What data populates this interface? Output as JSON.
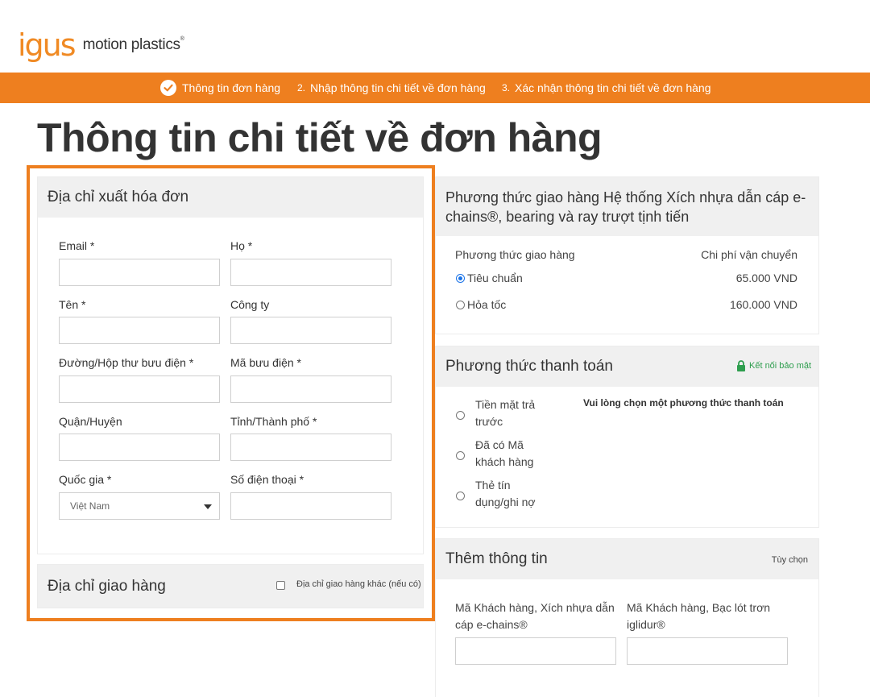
{
  "brand": {
    "logo": "igus",
    "tagline": "motion plastics",
    "tagline_mark": "®"
  },
  "steps": [
    {
      "label": "Thông tin đơn hàng",
      "number": ""
    },
    {
      "label": "Nhập thông tin chi tiết về đơn hàng",
      "number": "2."
    },
    {
      "label": "Xác nhận thông tin chi tiết về đơn hàng",
      "number": "3."
    }
  ],
  "page_title": "Thông tin chi tiết về đơn hàng",
  "billing": {
    "title": "Địa chỉ xuất hóa đơn",
    "fields": {
      "email": {
        "label": "Email *",
        "value": ""
      },
      "last_name": {
        "label": "Họ *",
        "value": ""
      },
      "first_name": {
        "label": "Tên *",
        "value": ""
      },
      "company": {
        "label": "Công ty",
        "value": ""
      },
      "street": {
        "label": "Đường/Hộp thư bưu điện *",
        "value": ""
      },
      "postcode": {
        "label": "Mã bưu điện *",
        "value": ""
      },
      "district": {
        "label": "Quận/Huyện",
        "value": ""
      },
      "city": {
        "label": "Tỉnh/Thành phố *",
        "value": ""
      },
      "country": {
        "label": "Quốc gia *",
        "selected": "Việt Nam"
      },
      "phone": {
        "label": "Số điện thoại *",
        "value": ""
      }
    }
  },
  "shipping_address": {
    "title": "Địa chỉ giao hàng",
    "checkbox_label": "Địa chỉ giao hàng khác (nếu có)"
  },
  "shipping_method": {
    "title": "Phương thức giao hàng Hệ thống Xích nhựa dẫn cáp e-chains®, bearing và ray trượt tịnh tiến",
    "col_method": "Phương thức giao hàng",
    "col_cost": "Chi phí vận chuyển",
    "options": [
      {
        "label": "Tiêu chuẩn",
        "cost": "65.000 VND",
        "checked": true
      },
      {
        "label": "Hỏa tốc",
        "cost": "160.000 VND",
        "checked": false
      }
    ]
  },
  "payment": {
    "title": "Phương thức thanh toán",
    "secure_label": "Kết nối bảo mật",
    "prompt": "Vui lòng chọn một phương thức thanh toán",
    "options": [
      {
        "line1": "Tiền mặt trả",
        "line2": "trước"
      },
      {
        "line1": "Đã có Mã",
        "line2": "khách hàng"
      },
      {
        "line1": "Thẻ tín",
        "line2": "dụng/ghi nợ"
      }
    ]
  },
  "extra_info": {
    "title": "Thêm thông tin",
    "optional": "Tùy chọn",
    "field1_line1": "Mã Khách hàng, Xích nhựa dẫn",
    "field1_line2": "cáp e-chains®",
    "field2_line1": "Mã Khách hàng, Bạc lót trơn",
    "field2_line2": "iglidur®"
  },
  "colors": {
    "accent": "#ee7f1f",
    "secure": "#2e9e4e",
    "radio_checked": "#1a73e8"
  }
}
